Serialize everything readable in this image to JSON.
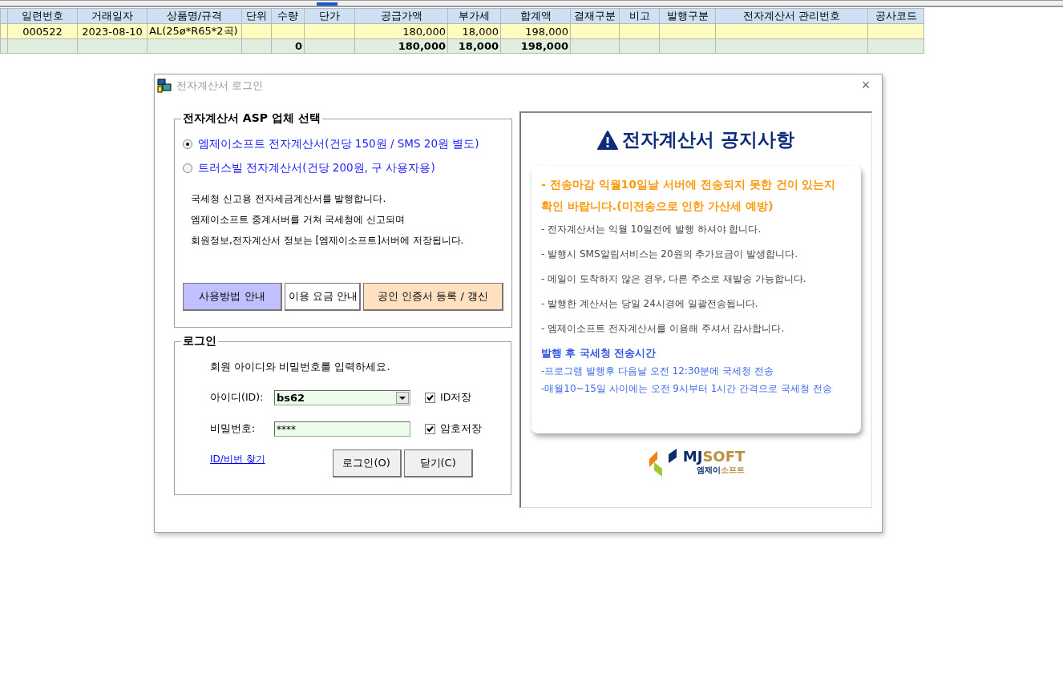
{
  "grid": {
    "columns": [
      {
        "label": "일련번호",
        "item": "000522"
      },
      {
        "label": "거래일자",
        "item": "2023-08-10"
      },
      {
        "label": "상품명/규격",
        "item": "AL(25ø*R65*2곡)"
      },
      {
        "label": "단위"
      },
      {
        "label": "수량",
        "total": "0"
      },
      {
        "label": "단가"
      },
      {
        "label": "공급가액",
        "item": "180,000",
        "total": "180,000"
      },
      {
        "label": "부가세",
        "item": "18,000",
        "total": "18,000"
      },
      {
        "label": "합계액",
        "item": "198,000",
        "total": "198,000"
      },
      {
        "label": "결재구분"
      },
      {
        "label": "비고"
      },
      {
        "label": "발행구분"
      },
      {
        "label": "전자계산서 관리번호"
      },
      {
        "label": "공사코드"
      }
    ]
  },
  "dialog": {
    "title": "전자계산서 로그인",
    "close": "×",
    "provider_group": {
      "title": "전자계산서 ASP 업체 선택",
      "options": [
        {
          "label": "엠제이소프트 전자계산서(건당 150원 / SMS 20원 별도)",
          "selected": true
        },
        {
          "label": "트러스빌 전자계산서(건당 200원, 구 사용자용)",
          "selected": false
        }
      ],
      "description": [
        "국세청 신고용 전자세금계산서를 발행합니다.",
        "엠제이소프트 중계서버를 거쳐 국세청에 신고되며",
        "회원정보,전자계산서 정보는 [엠제이소프트]서버에 저장됩니다."
      ],
      "buttons": [
        {
          "label": "사용방법 안내",
          "color": "#c0c0ff"
        },
        {
          "label": "이용 요금 안내",
          "color": "#ffffff"
        },
        {
          "label": "공인 인증서 등록 / 갱신",
          "color": "#ffe0c0"
        }
      ]
    },
    "login_group": {
      "title": "로그인",
      "prompt": "회원 아이디와 비밀번호를 입력하세요.",
      "fields": [
        {
          "kind": "dropdown",
          "label": "아이디(ID):",
          "value": "bs62",
          "save_label": "ID저장",
          "save_checked": true
        },
        {
          "kind": "password",
          "label": "비밀번호:",
          "value": "****",
          "save_label": "암호저장",
          "save_checked": true
        }
      ],
      "find_link": "ID/비번 찾기",
      "buttons": [
        "로그인(O)",
        "닫기(C)"
      ]
    },
    "notice": {
      "title": "전자계산서 공지사항",
      "highlight": "- 전송마감 익월10일날 서버에 전송되지 못한 건이 있는지 확인 바랍니다.(미전송으로 인한 가산세 예방)",
      "items": [
        "- 전자계산서는 익월 10일전에 발행 하셔야 합니다.",
        "- 발행시 SMS알림서비스는 20원의 추가요금이 발생합니다.",
        "- 메일이 도착하지 않은 경우, 다른 주소로 재발송 가능합니다.",
        "- 발행한 계산서는 당일 24시경에 일괄전송됩니다.",
        "- 엠제이소프트 전자계산서를 이용해 주셔서 감사합니다."
      ],
      "schedule_title": "발행 후 국세청 전송시간",
      "schedule": [
        "-프로그램 발행후 다음날 오전 12:30분에 국세청 전송",
        "-매월10~15일 사이에는 오전 9시부터 1시간 간격으로 국세청 전송"
      ],
      "logo": {
        "mark_left": "MJ",
        "mark_right": "SOFT",
        "sub_left": "엠제이",
        "sub_right": "소프트"
      }
    }
  }
}
